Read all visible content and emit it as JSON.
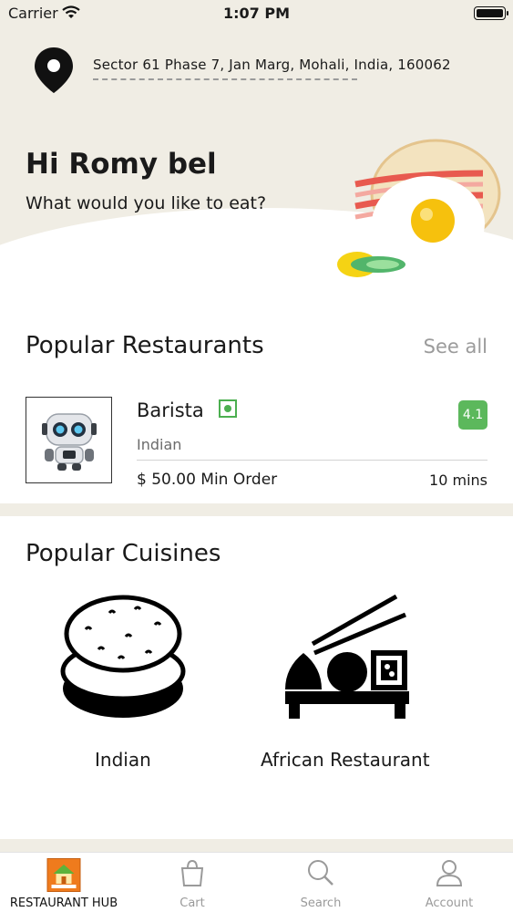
{
  "status_bar": {
    "carrier": "Carrier",
    "time": "1:07 PM"
  },
  "location": {
    "address": "Sector 61 Phase 7, Jan Marg, Mohali, India, 160062"
  },
  "hero": {
    "greeting": "Hi Romy bel",
    "subtitle": "What would you like to eat?"
  },
  "popular_restaurants": {
    "title": "Popular Restaurants",
    "see_all": "See all",
    "items": [
      {
        "name": "Barista",
        "cuisine": "Indian",
        "rating": "4.1",
        "min_order": "$ 50.00 Min Order",
        "eta": "10 mins"
      }
    ]
  },
  "popular_cuisines": {
    "title": "Popular Cuisines",
    "items": [
      {
        "label": "Indian",
        "icon": "bread-icon"
      },
      {
        "label": "African Restaurant",
        "icon": "sushi-icon"
      }
    ]
  },
  "tabbar": {
    "tabs": [
      {
        "label": "RESTAURANT HUB",
        "icon": "restaurant-hub-logo",
        "active": true
      },
      {
        "label": "Cart",
        "icon": "bag-icon",
        "active": false
      },
      {
        "label": "Search",
        "icon": "search-icon",
        "active": false
      },
      {
        "label": "Account",
        "icon": "user-icon",
        "active": false
      }
    ]
  },
  "colors": {
    "hero_bg": "#f0ede4",
    "rating_bg": "#5cb85c",
    "veg": "#4caf50",
    "muted": "#9b9b9b"
  }
}
